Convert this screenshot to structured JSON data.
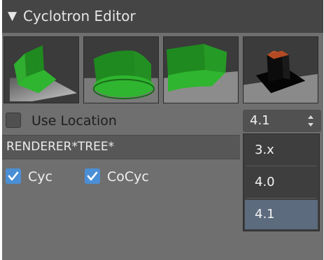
{
  "header": {
    "expand_arrow": "▼",
    "title": "Cyclotron Editor"
  },
  "shape_buttons": [
    {
      "name": "corner-flat",
      "icon": "cyclorama-corner-icon"
    },
    {
      "name": "curved-round",
      "icon": "cyclorama-round-icon"
    },
    {
      "name": "wall-curved",
      "icon": "cyclorama-wall-icon"
    },
    {
      "name": "dark-box",
      "icon": "dark-box-icon"
    }
  ],
  "use_location": {
    "label": "Use Location",
    "checked": false
  },
  "version_select": {
    "value": "4.1",
    "options": [
      "3.x",
      "4.0",
      "4.1"
    ]
  },
  "renderer_field": {
    "value": "RENDERER*TREE*"
  },
  "checkboxes": [
    {
      "label": "Cyc",
      "checked": true
    },
    {
      "label": "CoCyc",
      "checked": true
    }
  ],
  "colors": {
    "panel": "#6f6f6f",
    "header": "#454545",
    "check_accent": "#4a8fd6",
    "menu_selected": "#5c6b7e",
    "shape_green": "#2fa02f"
  }
}
